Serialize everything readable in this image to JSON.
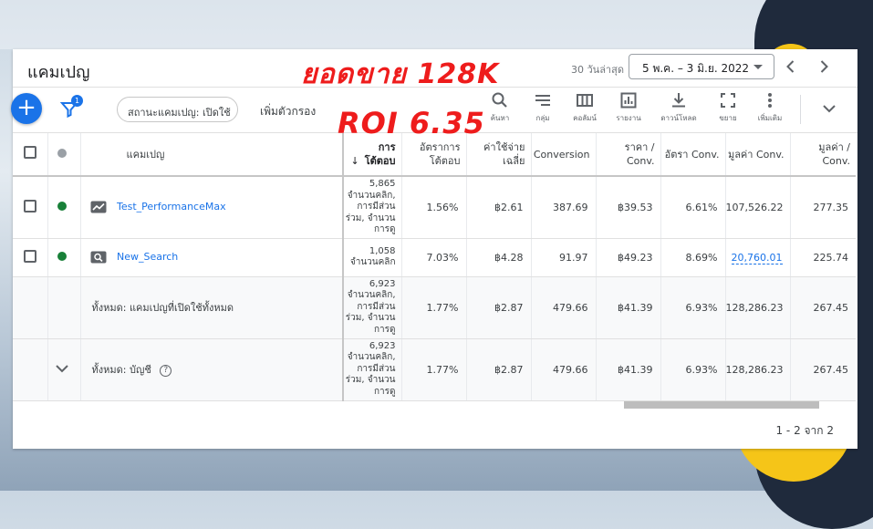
{
  "header": {
    "title": "แคมเปญ",
    "date_range_label": "30 วันล่าสุด",
    "date_range_value": "5 พ.ค. – 3 มิ.ย. 2022",
    "prev_label": "‹",
    "next_label": "›"
  },
  "overlays": {
    "sales": "ยอดขาย 128K",
    "roi": "ROI 6.35"
  },
  "toolbar": {
    "fab_label": "+",
    "filter_badge": "1",
    "status_filter": "สถานะแคมเปญ: เปิดใช้",
    "add_filter": "เพิ่มตัวกรอง",
    "tools": [
      {
        "label": "ค้นหา",
        "icon": "search-icon"
      },
      {
        "label": "กลุ่ม",
        "icon": "segment-icon"
      },
      {
        "label": "คอลัมน์",
        "icon": "columns-icon"
      },
      {
        "label": "รายงาน",
        "icon": "reports-icon"
      },
      {
        "label": "ดาวน์โหลด",
        "icon": "download-icon"
      },
      {
        "label": "ขยาย",
        "icon": "expand-icon"
      },
      {
        "label": "เพิ่มเติม",
        "icon": "more-icon"
      }
    ]
  },
  "table": {
    "headers": {
      "campaign": "แคมเปญ",
      "interactions_line1": "การ",
      "interactions_line2": "โต้ตอบ",
      "interaction_rate_line1": "อัตราการ",
      "interaction_rate_line2": "โต้ตอบ",
      "avg_cost_line1": "ค่าใช้จ่าย",
      "avg_cost_line2": "เฉลี่ย",
      "conversion": "Conversion",
      "cost_conv_line1": "ราคา /",
      "cost_conv_line2": "Conv.",
      "conv_rate": "อัตรา Conv.",
      "conv_value": "มูลค่า Conv.",
      "value_conv_line1": "มูลค่า /",
      "value_conv_line2": "Conv."
    },
    "rows": [
      {
        "name": "Test_PerformanceMax",
        "icon": "performance-max-icon",
        "status_color": "#188038",
        "interactions": [
          "5,865",
          "จำนวนคลิก,",
          "การมีส่วน",
          "ร่วม, จำนวน",
          "การดู"
        ],
        "interaction_rate": "1.56%",
        "avg_cost": "฿2.61",
        "conversions": "387.69",
        "cost_conv": "฿39.53",
        "conv_rate": "6.61%",
        "conv_value": "107,526.22",
        "value_conv": "277.35"
      },
      {
        "name": "New_Search",
        "icon": "search-campaign-icon",
        "status_color": "#188038",
        "interactions": [
          "1,058",
          "จำนวนคลิก"
        ],
        "interaction_rate": "7.03%",
        "avg_cost": "฿4.28",
        "conversions": "91.97",
        "cost_conv": "฿49.23",
        "conv_rate": "8.69%",
        "conv_value": "20,760.01",
        "value_conv": "225.74"
      }
    ],
    "totals": [
      {
        "label": "ทั้งหมด: แคมเปญที่เปิดใช้ทั้งหมด",
        "interactions": [
          "6,923",
          "จำนวนคลิก,",
          "การมีส่วน",
          "ร่วม, จำนวน",
          "การดู"
        ],
        "interaction_rate": "1.77%",
        "avg_cost": "฿2.87",
        "conversions": "479.66",
        "cost_conv": "฿41.39",
        "conv_rate": "6.93%",
        "conv_value": "128,286.23",
        "value_conv": "267.45"
      },
      {
        "label": "ทั้งหมด: บัญชี",
        "interactions": [
          "6,923",
          "จำนวนคลิก,",
          "การมีส่วน",
          "ร่วม, จำนวน",
          "การดู"
        ],
        "interaction_rate": "1.77%",
        "avg_cost": "฿2.87",
        "conversions": "479.66",
        "cost_conv": "฿41.39",
        "conv_rate": "6.93%",
        "conv_value": "128,286.23",
        "value_conv": "267.45"
      }
    ]
  },
  "pagination": "1 - 2 จาก 2",
  "colors": {
    "accent": "#1a73e8",
    "overlay_text": "#ee1c1c",
    "status_enabled": "#188038"
  }
}
